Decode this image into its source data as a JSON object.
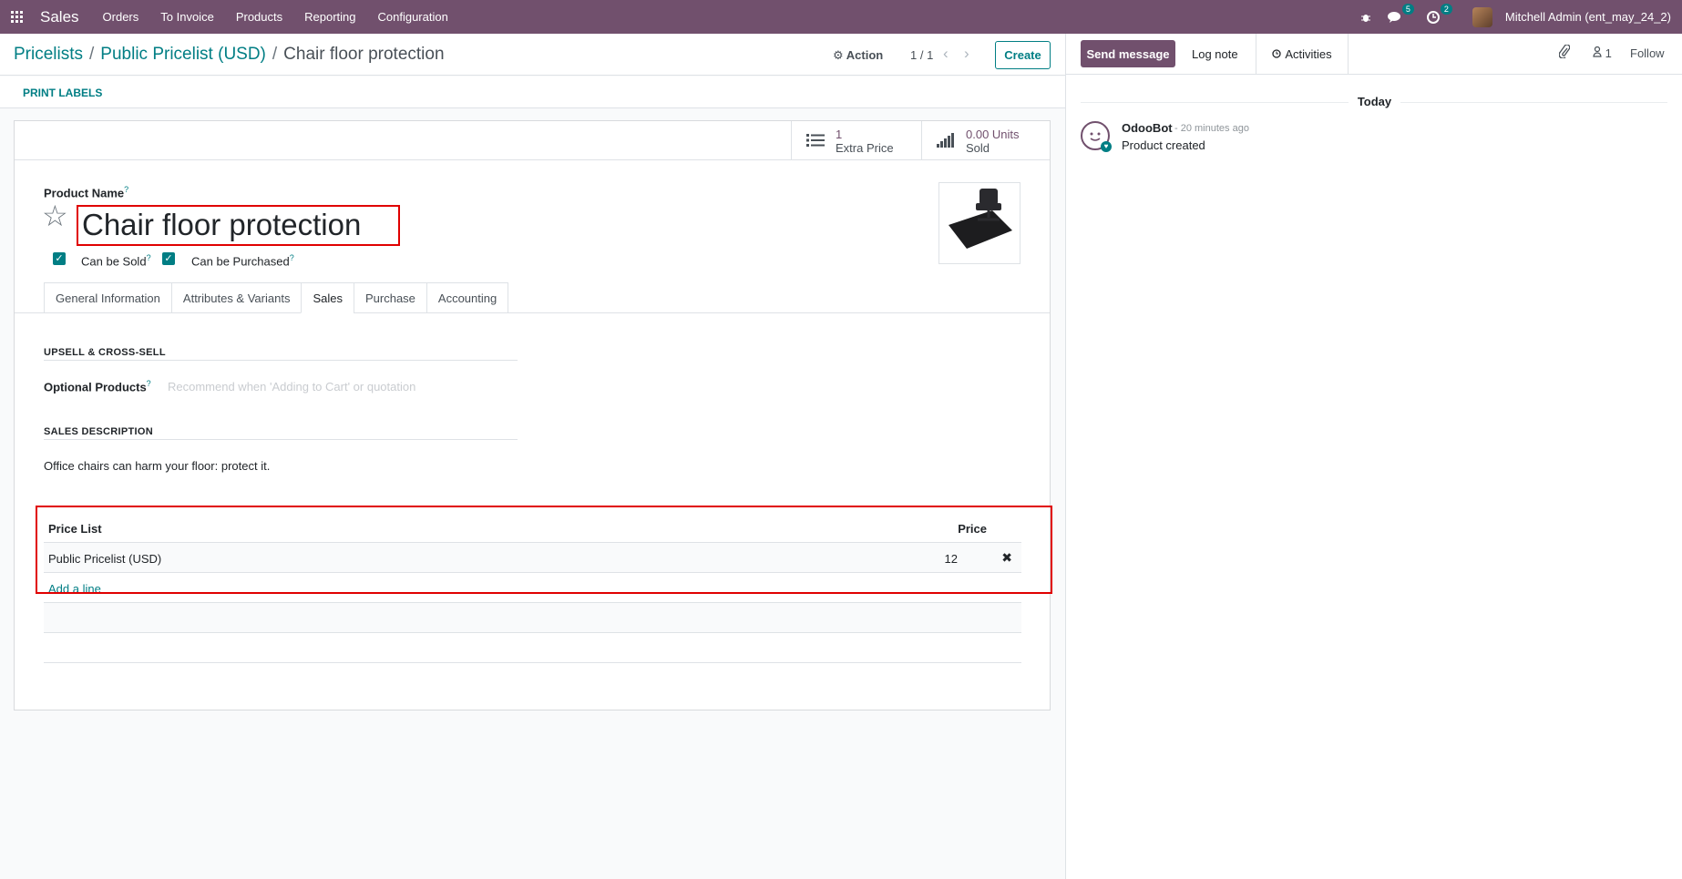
{
  "navbar": {
    "app_name": "Sales",
    "menu": [
      "Orders",
      "To Invoice",
      "Products",
      "Reporting",
      "Configuration"
    ],
    "messages_count": "5",
    "activities_count": "2",
    "user": "Mitchell Admin (ent_may_24_2)"
  },
  "breadcrumb": {
    "items": [
      "Pricelists",
      "Public Pricelist (USD)"
    ],
    "current": "Chair floor protection"
  },
  "control": {
    "action_label": "Action",
    "pager": "1 / 1",
    "create_label": "Create"
  },
  "statusbar": {
    "print_labels": "PRINT LABELS"
  },
  "stats": {
    "extra_value": "1",
    "extra_label": "Extra Price",
    "sold_value": "0.00 Units",
    "sold_label": "Sold"
  },
  "product": {
    "name_label": "Product Name",
    "name": "Chair floor protection",
    "can_be_sold_label": "Can be Sold",
    "can_be_purchased_label": "Can be Purchased",
    "can_be_sold": true,
    "can_be_purchased": true
  },
  "tabs": [
    "General Information",
    "Attributes & Variants",
    "Sales",
    "Purchase",
    "Accounting"
  ],
  "active_tab": "Sales",
  "sales": {
    "upsell_title": "UPSELL & CROSS-SELL",
    "optional_label": "Optional Products",
    "optional_placeholder": "Recommend when 'Adding to Cart' or quotation",
    "description_title": "SALES DESCRIPTION",
    "description": "Office chairs can harm your floor: protect it."
  },
  "price_table": {
    "col_pricelist": "Price List",
    "col_price": "Price",
    "rows": [
      {
        "pricelist": "Public Pricelist (USD)",
        "price": "12"
      }
    ],
    "add_line": "Add a line"
  },
  "chatter": {
    "send_message": "Send message",
    "log_note": "Log note",
    "activities": "Activities",
    "followers": "1",
    "follow": "Follow",
    "date_separator": "Today",
    "message_author": "OdooBot",
    "message_time": "- 20 minutes ago",
    "message_body": "Product created"
  },
  "colors": {
    "brand": "#71506d",
    "accent": "#017e84",
    "highlight": "#e00000"
  }
}
